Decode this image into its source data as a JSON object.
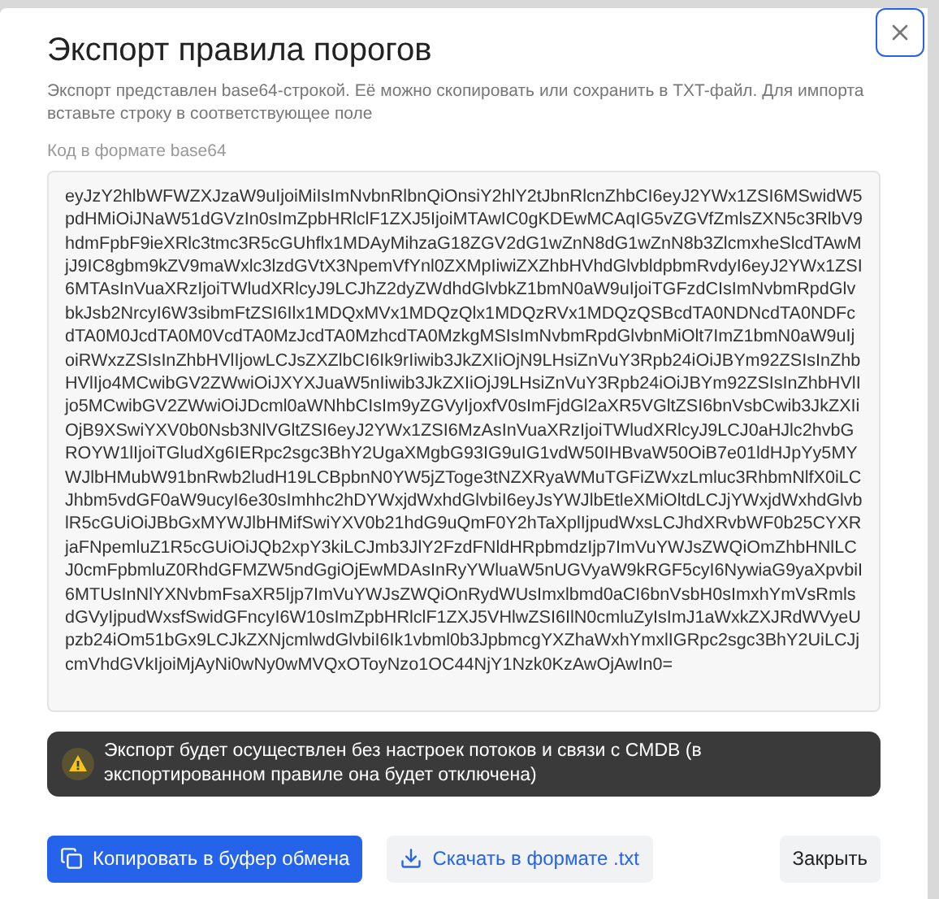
{
  "dialog": {
    "title": "Экспорт правила порогов",
    "description": "Экспорт представлен base64-строкой. Её можно скопировать или сохранить в TXT-файл. Для импорта вставьте строку в соответствующее поле",
    "code_label": "Код в формате base64",
    "code": "eyJzY2hlbWFWZXJzaW9uIjoiMiIsImNvbnRlbnQiOnsiY2hlY2tJbnRlcnZhbCI6eyJ2YWx1ZSI6MSwidW5pdHMiOiJNaW51dGVzIn0sImZpbHRlclF1ZXJ5IjoiMTAwIC0gKDEwMCAqIG5vZGVfZmlsZXN5c3RlbV9hdmFpbF9ieXRlc3tmc3R5cGUhflx1MDAyMihzaG18ZGV2dG1wZnN8dG1wZnN8b3ZlcmxheSlcdTAwMjJ9IC8gbm9kZV9maWxlc3lzdGVtX3NpemVfYnl0ZXMpIiwiZXZhbHVhdGlvbldpbmRvdyI6eyJ2YWx1ZSI6MTAsInVuaXRzIjoiTWludXRlcyJ9LCJhZ2dyZWdhdGlvbkZ1bmN0aW9uIjoiTGFzdCIsImNvbmRpdGlvbkJsb2NrcyI6W3sibmFtZSI6Ilx1MDQxMVx1MDQzQlx1MDQzRVx1MDQzQSBcdTA0NDNcdTA0NDFcdTA0M0JcdTA0M0VcdTA0MzJcdTA0MzhcdTA0MzkgMSIsImNvbmRpdGlvbnMiOlt7ImZ1bmN0aW9uIjoiRWxzZSIsInZhbHVlIjowLCJsZXZlbCI6Ik9rIiwib3JkZXIiOjN9LHsiZnVuY3Rpb24iOiJBYm92ZSIsInZhbHVlIjo4MCwibGV2ZWwiOiJXYXJuaW5nIiwib3JkZXIiOjJ9LHsiZnVuY3Rpb24iOiJBYm92ZSIsInZhbHVlIjo5MCwibGV2ZWwiOiJDcml0aWNhbCIsIm9yZGVyIjoxfV0sImFjdGl2aXR5VGltZSI6bnVsbCwib3JkZXIiOjB9XSwiYXV0b0Nsb3NlVGltZSI6eyJ2YWx1ZSI6MzAsInVuaXRzIjoiTWludXRlcyJ9LCJ0aHJlc2hvbGROYW1lIjoiTGludXg6IERpc2sgc3BhY2UgaXMgbG93IG9uIG1vdW50IHBvaW50OiB7e01ldHJpYy5MYWJlbHMubW91bnRwb2ludH19LCBpbnN0YW5jZToge3tNZXRyaWMuTGFiZWxzLmluc3RhbmNlfX0iLCJhbm5vdGF0aW9ucyI6e30sImhhc2hDYWxjdWxhdGlvbiI6eyJsYWJlbEtleXMiOltdLCJjYWxjdWxhdGlvblR5cGUiOiJBbGxMYWJlbHMifSwiYXV0b21hdG9uQmF0Y2hTaXplIjpudWxsLCJhdXRvbWF0b25CYXRjaFNpemluZ1R5cGUiOiJQb2xpY3kiLCJmb3JlY2FzdFNldHRpbmdzIjp7ImVuYWJsZWQiOmZhbHNlLCJ0cmFpbmluZ0RhdGFMZW5ndGgiOjEwMDAsInRyYWluaW5nUGVyaW9kRGF5cyI6NywiaG9yaXpvbiI6MTUsInNlYXNvbmFsaXR5Ijp7ImVuYWJsZWQiOnRydWUsImxlbmd0aCI6bnVsbH0sImxhYmVsRmlsdGVyIjpudWxsfSwidGFncyI6W10sImZpbHRlclF1ZXJ5VHlwZSI6IlN0cmluZyIsImJ1aWxkZXJRdWVyeUpzb24iOm51bGx9LCJkZXNjcmlwdGlvbiI6Ik1vbml0b3JpbmcgYXZhaWxhYmxlIGRpc2sgc3BhY2UiLCJjcmVhdGVkIjoiMjAyNi0wNy0wMVQxOToyNzo1OC44NjY1Nzk0KzAwOjAwIn0=",
    "warning": "Экспорт будет осуществлен без настроек потоков и связи с CMDB (в экспортированном правиле она будет отключена)",
    "buttons": [
      {
        "kind": "primary",
        "label": "Копировать в буфер обмена"
      },
      {
        "kind": "download",
        "label": "Скачать в формате .txt"
      },
      {
        "kind": "secondary",
        "label": "Закрыть"
      }
    ]
  }
}
